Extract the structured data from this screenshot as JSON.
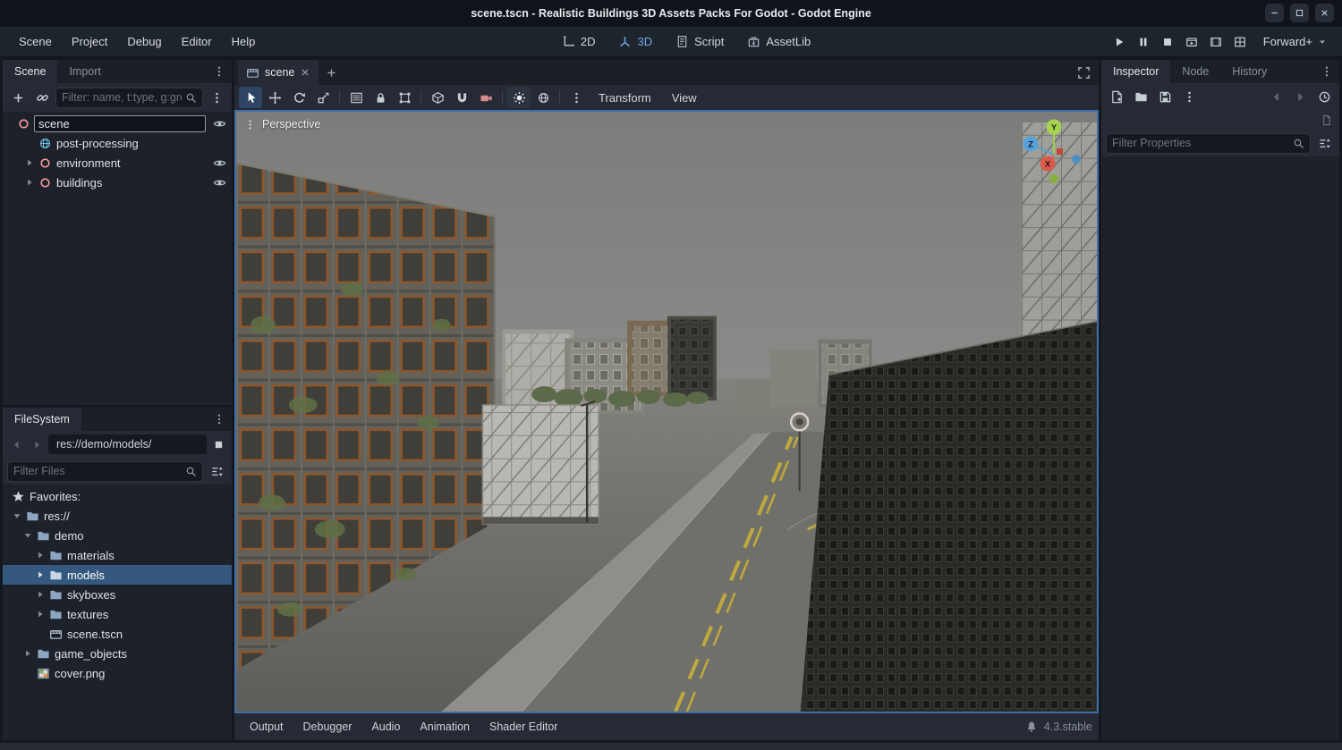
{
  "titlebar": {
    "title": "scene.tscn - Realistic Buildings 3D Assets Packs For Godot - Godot Engine"
  },
  "menubar": {
    "items": [
      "Scene",
      "Project",
      "Debug",
      "Editor",
      "Help"
    ],
    "modes": [
      {
        "label": "2D"
      },
      {
        "label": "3D",
        "active": true
      },
      {
        "label": "Script"
      },
      {
        "label": "AssetLib"
      }
    ],
    "renderer": "Forward+"
  },
  "scene_dock": {
    "tabs": [
      "Scene",
      "Import"
    ],
    "filter_placeholder": "Filter: name, t:type, g:group",
    "nodes": [
      {
        "label": "scene",
        "renaming": true
      },
      {
        "label": "post-processing"
      },
      {
        "label": "environment",
        "collapsed": true
      },
      {
        "label": "buildings",
        "collapsed": true
      }
    ]
  },
  "filesystem": {
    "tab": "FileSystem",
    "path": "res://demo/models/",
    "filter_placeholder": "Filter Files",
    "items": [
      {
        "label": "Favorites:"
      },
      {
        "label": "res://"
      },
      {
        "label": "demo"
      },
      {
        "label": "materials"
      },
      {
        "label": "models",
        "selected": true
      },
      {
        "label": "skyboxes"
      },
      {
        "label": "textures"
      },
      {
        "label": "scene.tscn"
      },
      {
        "label": "game_objects"
      },
      {
        "label": "cover.png"
      }
    ]
  },
  "center": {
    "scene_tab": "scene",
    "perspective": "Perspective",
    "transform_menu": "Transform",
    "view_menu": "View",
    "gizmo": {
      "x": "X",
      "y": "Y",
      "z": "Z"
    }
  },
  "inspector": {
    "tabs": [
      "Inspector",
      "Node",
      "History"
    ],
    "filter_placeholder": "Filter Properties"
  },
  "bottom": {
    "panels": [
      "Output",
      "Debugger",
      "Audio",
      "Animation",
      "Shader Editor"
    ],
    "version": "4.3.stable"
  },
  "icons": {
    "minimize": "–",
    "maximize": "□",
    "close": "✕",
    "search": "magnifier",
    "menu": "vertical-dots",
    "add_node": "+",
    "instance_scene": "chain-link",
    "visibility": "eye",
    "expand": "▸",
    "collapse": "▾",
    "favorite": "★",
    "folder": "folder",
    "scene_file": "clapperboard",
    "image_file": "checkerboard",
    "back": "‹",
    "forward": "›",
    "select_tool": "cursor-arrow",
    "move_tool": "cross-arrows",
    "rotate_tool": "circular-arrow",
    "scale_tool": "resize-arrow",
    "selection_list": "list-box",
    "lock": "padlock",
    "group": "corner-handles",
    "local_space": "cube",
    "snap": "magnet",
    "camera_preview": "camera",
    "sun": "sun",
    "environment": "globe",
    "play": "▶",
    "pause": "⏸",
    "stop": "⏹",
    "bell": "bell",
    "fullscreen": "corner-brackets"
  },
  "colors": {
    "accent": "#699ce8",
    "selection": "#35587e",
    "viewport_border": "#3f6ea8",
    "sky": "#828282",
    "road_line": "#c0a93c"
  }
}
